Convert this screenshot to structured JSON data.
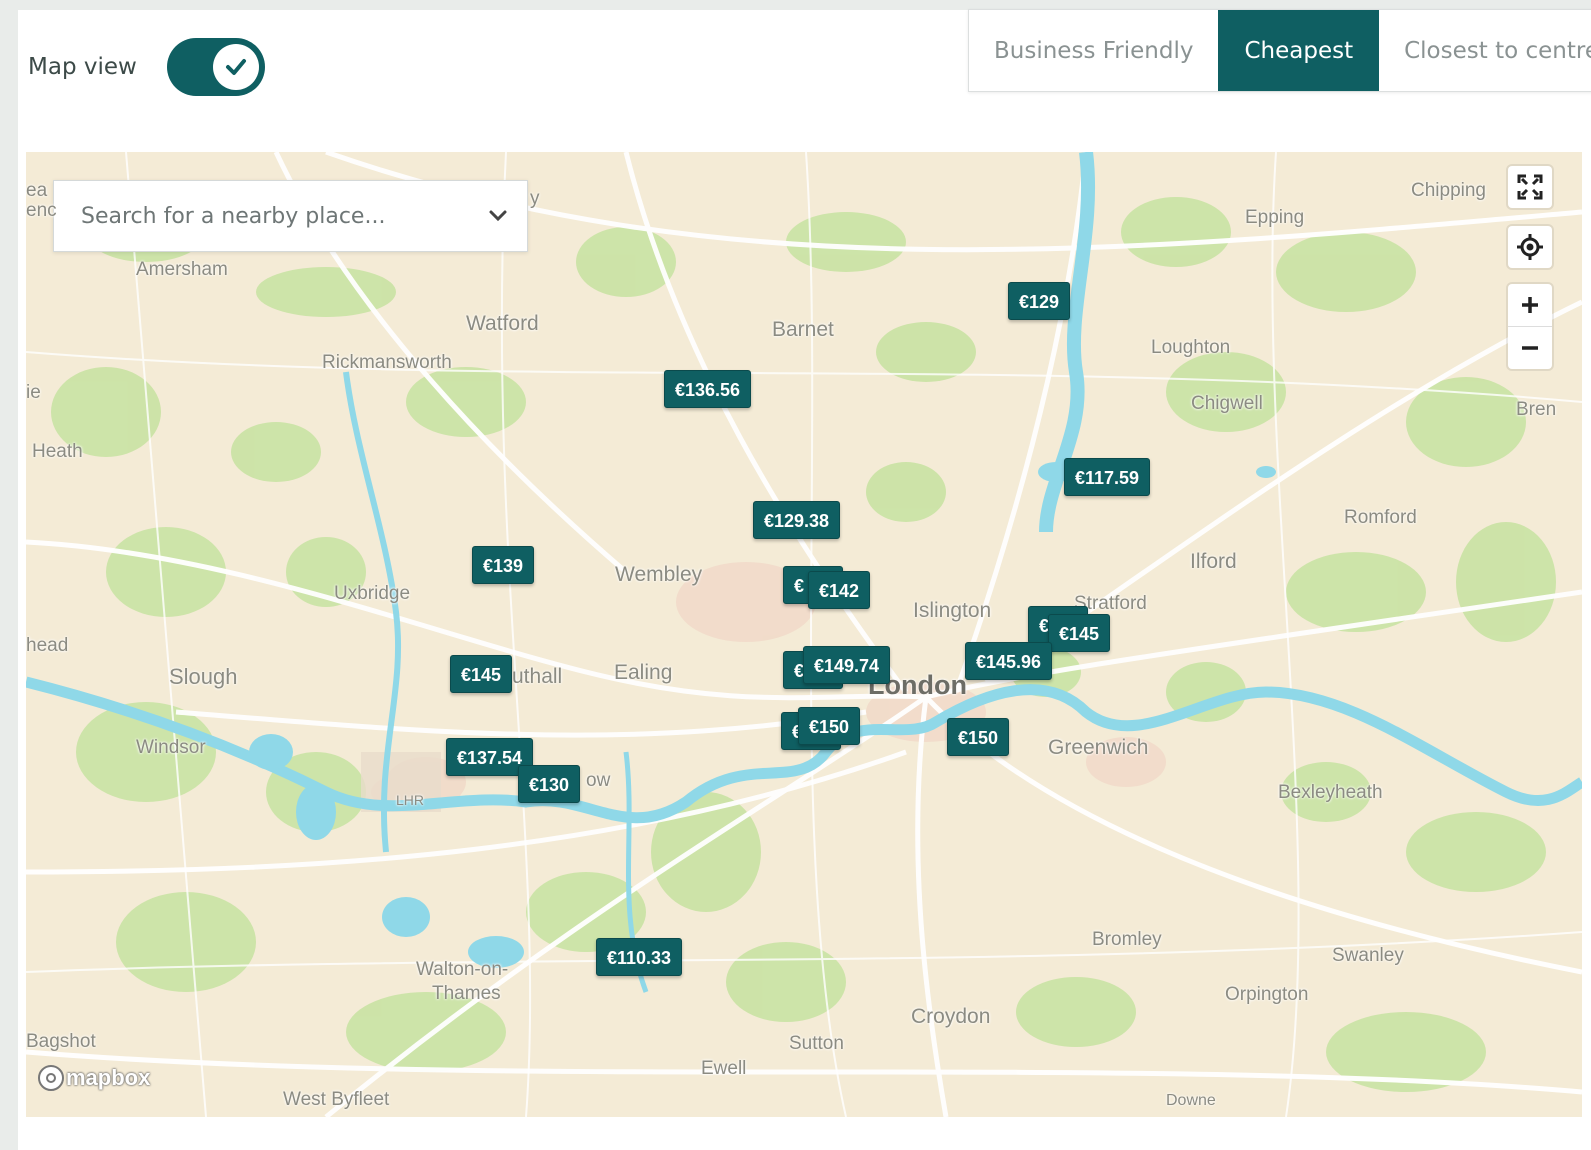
{
  "toggle": {
    "label": "Map view",
    "checked": true
  },
  "sort_tabs": [
    {
      "label": "Business Friendly",
      "active": false
    },
    {
      "label": "Cheapest",
      "active": true
    },
    {
      "label": "Closest to centre",
      "active": false
    }
  ],
  "search": {
    "placeholder": "Search for a nearby place..."
  },
  "places": [
    {
      "name": "Amersham"
    },
    {
      "name": "Watford"
    },
    {
      "name": "Barnet"
    },
    {
      "name": "Rickmansworth"
    },
    {
      "name": "Epping"
    },
    {
      "name": "Chipping"
    },
    {
      "name": "Loughton"
    },
    {
      "name": "Chigwell"
    },
    {
      "name": "Bren"
    },
    {
      "name": "Heath"
    },
    {
      "name": "Romford"
    },
    {
      "name": "Ilford"
    },
    {
      "name": "Wembley"
    },
    {
      "name": "Uxbridge"
    },
    {
      "name": "Islington"
    },
    {
      "name": "Stratford"
    },
    {
      "name": "head"
    },
    {
      "name": "Slough"
    },
    {
      "name": "uthall"
    },
    {
      "name": "Ealing"
    },
    {
      "name": "London"
    },
    {
      "name": "Windsor"
    },
    {
      "name": "Greenwich"
    },
    {
      "name": "ow"
    },
    {
      "name": "Bexleyheath"
    },
    {
      "name": "LHR"
    },
    {
      "name": "Bromley"
    },
    {
      "name": "Swanley"
    },
    {
      "name": "Walton-on-"
    },
    {
      "name": "Thames"
    },
    {
      "name": "Orpington"
    },
    {
      "name": "Croydon"
    },
    {
      "name": "Bagshot"
    },
    {
      "name": "Sutton"
    },
    {
      "name": "Ewell"
    },
    {
      "name": "West Byfleet"
    },
    {
      "name": "Downe"
    },
    {
      "name": "ea"
    },
    {
      "name": "enc"
    },
    {
      "name": "ie"
    },
    {
      "name": "y"
    }
  ],
  "price_pins": [
    {
      "label": "€129"
    },
    {
      "label": "€136.56"
    },
    {
      "label": "€117.59"
    },
    {
      "label": "€129.38"
    },
    {
      "label": "€139"
    },
    {
      "label": "€"
    },
    {
      "label": "€142"
    },
    {
      "label": "€"
    },
    {
      "label": "€145"
    },
    {
      "label": "€145"
    },
    {
      "label": "€"
    },
    {
      "label": "€149.74"
    },
    {
      "label": "€145.96"
    },
    {
      "label": "€"
    },
    {
      "label": "€150"
    },
    {
      "label": "€150"
    },
    {
      "label": "€137.54"
    },
    {
      "label": "€130"
    },
    {
      "label": "€110.33"
    }
  ],
  "attribution": {
    "logo_text": "mapbox"
  },
  "colors": {
    "accent": "#0f5f62",
    "water": "#8fd8e8",
    "park": "#c9e3a4",
    "land": "#f4ebd6"
  }
}
